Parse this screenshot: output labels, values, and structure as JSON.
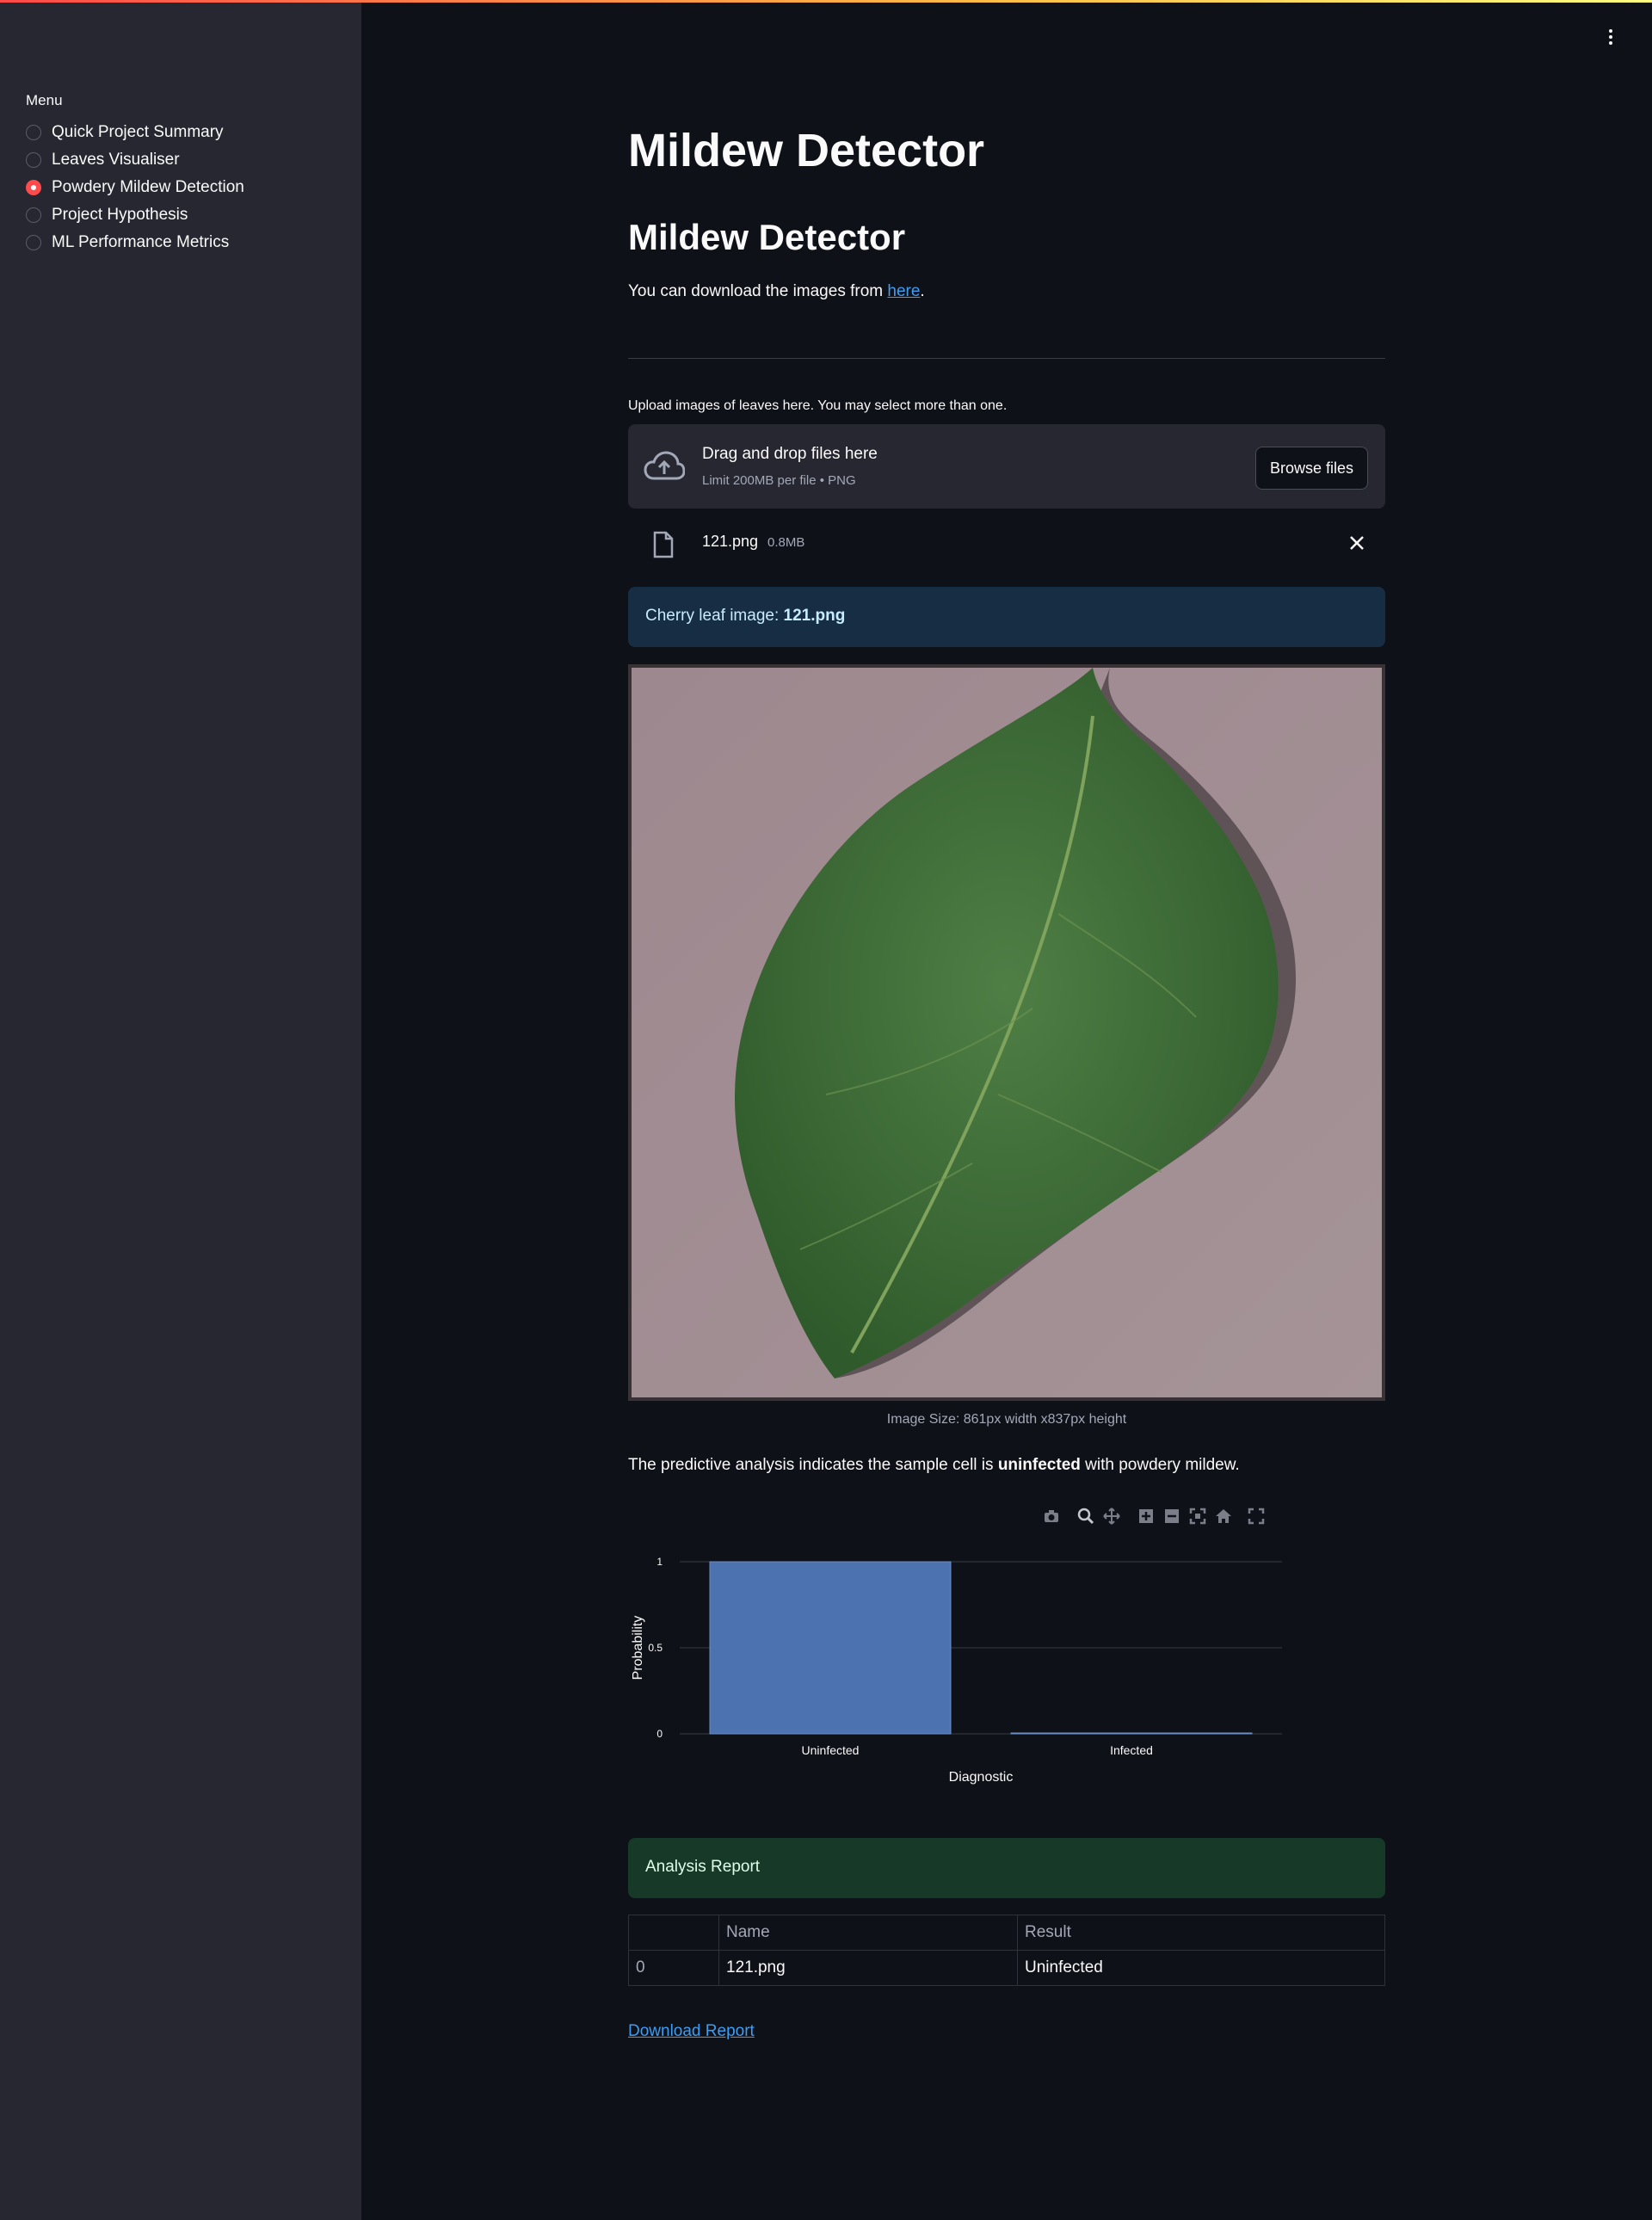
{
  "app": {
    "accent_color": "#ff4b4b",
    "kebab_icon": "vertical-dots-icon"
  },
  "sidebar": {
    "title": "Menu",
    "items": [
      {
        "label": "Quick Project Summary",
        "selected": false
      },
      {
        "label": "Leaves Visualiser",
        "selected": false
      },
      {
        "label": "Powdery Mildew Detection",
        "selected": true
      },
      {
        "label": "Project Hypothesis",
        "selected": false
      },
      {
        "label": "ML Performance Metrics",
        "selected": false
      }
    ]
  },
  "main": {
    "title": "Mildew Detector",
    "subtitle": "Mildew Detector",
    "download_text": "You can download the images from",
    "download_link": "here",
    "download_suffix": ".",
    "uploader": {
      "label": "Upload images of leaves here. You may select more than one.",
      "drop_title": "Drag and drop files here",
      "drop_sub": "Limit 200MB per file • PNG",
      "browse_label": "Browse files",
      "file_name": "121.png",
      "file_size": "0.8MB"
    },
    "info_prefix": "Cherry leaf image: ",
    "info_file": "121.png",
    "image_caption": "Image Size: 861px width x837px height",
    "result_prefix": "The predictive analysis indicates the sample cell is ",
    "result_value": "uninfected",
    "result_suffix": " with powdery mildew.",
    "success_text": "Analysis Report",
    "table": {
      "columns": [
        "",
        "Name",
        "Result"
      ],
      "rows": [
        [
          "0",
          "121.png",
          "Uninfected"
        ]
      ]
    },
    "download_report": "Download Report"
  },
  "chart_data": {
    "type": "bar",
    "categories": [
      "Uninfected",
      "Infected"
    ],
    "values": [
      1,
      0
    ],
    "xlabel": "Diagnostic",
    "ylabel": "Probability",
    "ylim": [
      0,
      1
    ],
    "yticks": [
      "0",
      "0.5",
      "1"
    ],
    "bar_color": "#4c72b0",
    "grid": true
  }
}
